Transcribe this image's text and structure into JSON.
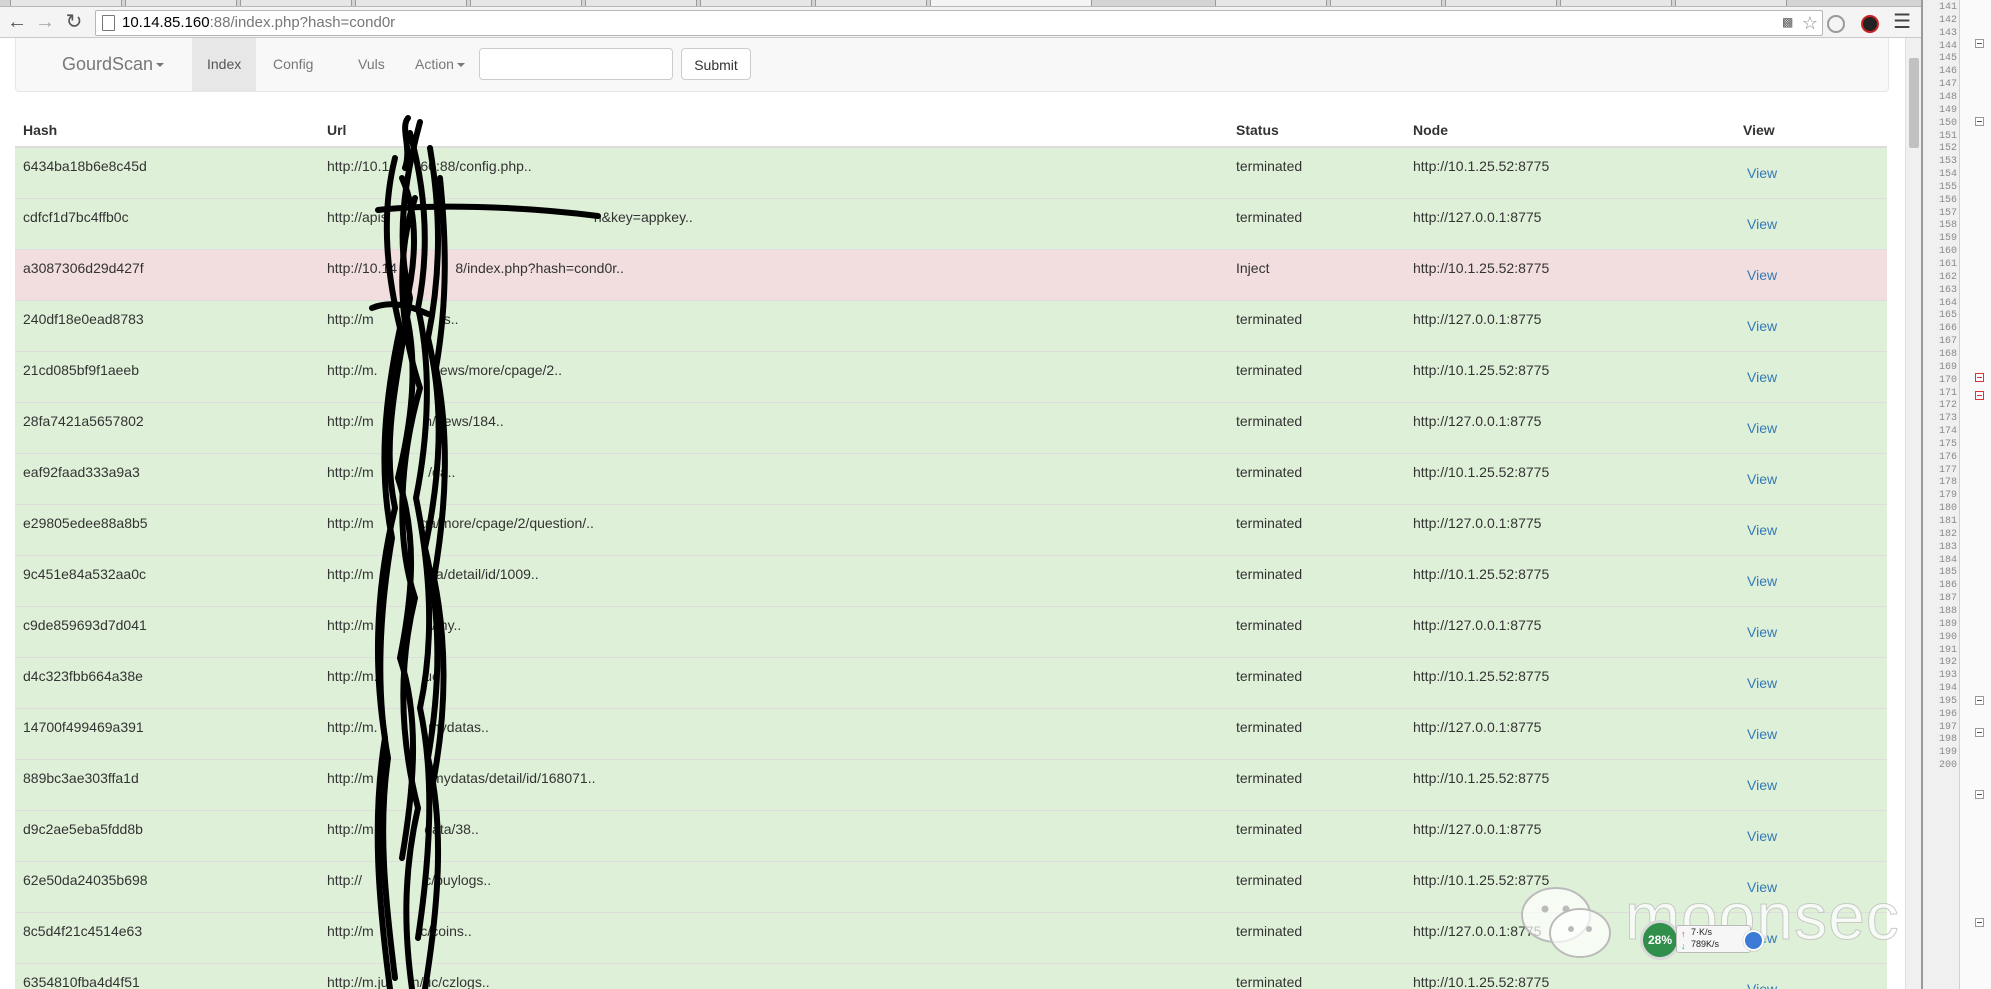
{
  "browser": {
    "url_host": "10.14.85.160",
    "url_rest": ":88/index.php?hash=cond0r"
  },
  "icons": {
    "back": "back-arrow-icon",
    "forward": "forward-arrow-icon",
    "reload": "reload-icon",
    "star": "bookmark-star-icon",
    "menu": "hamburger-menu-icon"
  },
  "navbar": {
    "brand": "GourdScan",
    "links": [
      "Index",
      "Config",
      "Vuls",
      "Action"
    ],
    "search_value": "",
    "submit_label": "Submit"
  },
  "table": {
    "columns": [
      "Hash",
      "Url",
      "Status",
      "Node",
      "View"
    ],
    "rows": [
      {
        "hash": "6434ba18b6e8c45d",
        "url": "http://10.1        60:88/config.php..",
        "status": "terminated",
        "node": "http://10.1.25.52:8775",
        "view": "View",
        "state": "success"
      },
      {
        "hash": "cdfcf1d7bc4ffb0c",
        "url": "http://apis                                                     n&key=appkey..",
        "status": "terminated",
        "node": "http://127.0.0.1:8775",
        "view": "View",
        "state": "success"
      },
      {
        "hash": "a3087306d29d427f",
        "url": "http://10.14               8/index.php?hash=cond0r..",
        "status": "Inject",
        "node": "http://10.1.25.52:8775",
        "view": "View",
        "state": "danger"
      },
      {
        "hash": "240df18e0ead8783",
        "url": "http://m                  s..",
        "status": "terminated",
        "node": "http://127.0.0.1:8775",
        "view": "View",
        "state": "success"
      },
      {
        "hash": "21cd085bf9f1aeeb",
        "url": "http://m.              news/more/cpage/2..",
        "status": "terminated",
        "node": "http://10.1.25.52:8775",
        "view": "View",
        "state": "success"
      },
      {
        "hash": "28fa7421a5657802",
        "url": "http://m             n/news/184..",
        "status": "terminated",
        "node": "http://127.0.0.1:8775",
        "view": "View",
        "state": "success"
      },
      {
        "hash": "eaf92faad333a9a3",
        "url": "http://m              /qa..",
        "status": "terminated",
        "node": "http://10.1.25.52:8775",
        "view": "View",
        "state": "success"
      },
      {
        "hash": "e29805edee88a8b5",
        "url": "http://m            qa/more/cpage/2/question/..",
        "status": "terminated",
        "node": "http://127.0.0.1:8775",
        "view": "View",
        "state": "success"
      },
      {
        "hash": "9c451e84a532aa0c",
        "url": "http://m              qa/detail/id/1009..",
        "status": "terminated",
        "node": "http://10.1.25.52:8775",
        "view": "View",
        "state": "success"
      },
      {
        "hash": "c9de859693d7d041",
        "url": "http://m               /my..",
        "status": "terminated",
        "node": "http://127.0.0.1:8775",
        "view": "View",
        "state": "success"
      },
      {
        "hash": "d4c323fbb664a38e",
        "url": "http://m.            uc",
        "status": "terminated",
        "node": "http://10.1.25.52:8775",
        "view": "View",
        "state": "success"
      },
      {
        "hash": "14700f499469a391",
        "url": "http://m.             mydatas..",
        "status": "terminated",
        "node": "http://127.0.0.1:8775",
        "view": "View",
        "state": "success"
      },
      {
        "hash": "889bc3ae303ffa1d",
        "url": "http://m              /mydatas/detail/id/168071..",
        "status": "terminated",
        "node": "http://10.1.25.52:8775",
        "view": "View",
        "state": "success"
      },
      {
        "hash": "d9c2ae5eba5fdd8b",
        "url": "http://m             data/38..",
        "status": "terminated",
        "node": "http://127.0.0.1:8775",
        "view": "View",
        "state": "success"
      },
      {
        "hash": "62e50da24035b698",
        "url": "http://                c/buylogs..",
        "status": "terminated",
        "node": "http://10.1.25.52:8775",
        "view": "View",
        "state": "success"
      },
      {
        "hash": "8c5d4f21c4514e63",
        "url": "http://m            c/coins..",
        "status": "terminated",
        "node": "http://127.0.0.1:8775",
        "view": "View",
        "state": "success"
      },
      {
        "hash": "6354810fba4d4f51",
        "url": "http://m.ju      n/uc/czlogs..",
        "status": "terminated",
        "node": "http://10.1.25.52:8775",
        "view": "View",
        "state": "success"
      }
    ]
  },
  "netmon": {
    "percent": "28%",
    "upload": "7·K/s",
    "download": "789K/s"
  },
  "watermark": "moonsec",
  "editor": {
    "line_numbers": [
      "141",
      "142",
      "143",
      "144",
      "145",
      "146",
      "147",
      "148",
      "149",
      "150",
      "151",
      "152",
      "153",
      "154",
      "155",
      "156",
      "157",
      "158",
      "159",
      "160",
      "161",
      "162",
      "163",
      "164",
      "165",
      "166",
      "167",
      "168",
      "169",
      "170",
      "171",
      "172",
      "173",
      "174",
      "175",
      "176",
      "177",
      "178",
      "179",
      "180",
      "181",
      "182",
      "183",
      "184",
      "185",
      "186",
      "187",
      "188",
      "189",
      "190",
      "191",
      "192",
      "193",
      "194",
      "195",
      "196",
      "197",
      "198",
      "199",
      "200"
    ]
  },
  "colors": {
    "success_row": "#dff0d8",
    "danger_row": "#f2dede",
    "link": "#337ab7",
    "navbar_bg": "#f8f8f8"
  }
}
